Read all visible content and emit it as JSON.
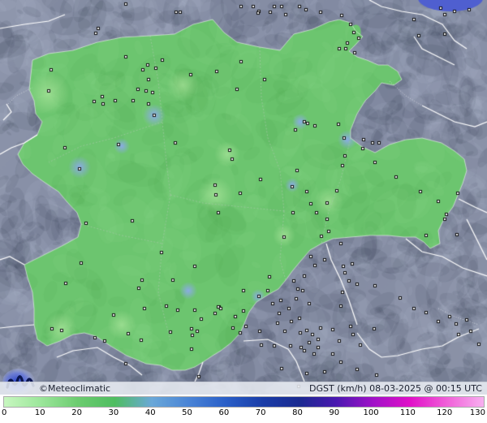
{
  "map": {
    "colors": {
      "ocean": "#4f5fd0",
      "terrain": "#8a92a8",
      "region_fill": "#6cc56f",
      "region_edge": "#5cb860",
      "border_line": "#ffffff",
      "province_line": "#9ec8a0",
      "hotspot": "#8ab4ee"
    }
  },
  "credit": "©Meteoclimatic",
  "caption": "DGST (km/h)   08-03-2025 @ 00:15 UTC",
  "legend": {
    "label": "DGST (km/h)",
    "ticks": [
      "0",
      "10",
      "20",
      "30",
      "40",
      "50",
      "60",
      "70",
      "80",
      "90",
      "100",
      "110",
      "120",
      "130"
    ],
    "stops": [
      "#c8f7c0",
      "#9be69a",
      "#6ccc70",
      "#4fbd60",
      "#6aa8d8",
      "#4a84d6",
      "#2a5fc8",
      "#1a3da8",
      "#1a2a90",
      "#4a18b0",
      "#a012c8",
      "#e010c8",
      "#f060d8",
      "#f8b0f0"
    ]
  },
  "stations": [
    [
      155,
      5
    ],
    [
      217,
      15
    ],
    [
      222,
      15
    ],
    [
      297,
      8
    ],
    [
      312,
      8
    ],
    [
      319,
      14
    ],
    [
      333,
      15
    ],
    [
      338,
      8
    ],
    [
      347,
      8
    ],
    [
      352,
      18
    ],
    [
      369,
      8
    ],
    [
      318,
      16
    ],
    [
      377,
      12
    ],
    [
      395,
      15
    ],
    [
      421,
      19
    ],
    [
      436,
      40
    ],
    [
      442,
      47
    ],
    [
      428,
      53
    ],
    [
      432,
      30
    ],
    [
      418,
      60
    ],
    [
      426,
      60
    ],
    [
      437,
      65
    ],
    [
      543,
      10
    ],
    [
      548,
      18
    ],
    [
      578,
      12
    ],
    [
      560,
      14
    ],
    [
      548,
      42
    ],
    [
      516,
      44
    ],
    [
      510,
      24
    ],
    [
      121,
      35
    ],
    [
      118,
      41
    ],
    [
      155,
      70
    ],
    [
      200,
      74
    ],
    [
      192,
      84
    ],
    [
      182,
      80
    ],
    [
      176,
      86
    ],
    [
      235,
      92
    ],
    [
      267,
      88
    ],
    [
      297,
      76
    ],
    [
      326,
      98
    ],
    [
      292,
      110
    ],
    [
      183,
      98
    ],
    [
      180,
      112
    ],
    [
      170,
      110
    ],
    [
      164,
      124
    ],
    [
      183,
      128
    ],
    [
      188,
      114
    ],
    [
      126,
      119
    ],
    [
      127,
      128
    ],
    [
      116,
      125
    ],
    [
      142,
      124
    ],
    [
      63,
      86
    ],
    [
      60,
      112
    ],
    [
      80,
      182
    ],
    [
      98,
      208
    ],
    [
      146,
      178
    ],
    [
      190,
      142
    ],
    [
      216,
      176
    ],
    [
      283,
      185
    ],
    [
      286,
      196
    ],
    [
      265,
      228
    ],
    [
      266,
      240
    ],
    [
      269,
      262
    ],
    [
      296,
      238
    ],
    [
      321,
      221
    ],
    [
      360,
      230
    ],
    [
      361,
      262
    ],
    [
      366,
      210
    ],
    [
      378,
      236
    ],
    [
      383,
      251
    ],
    [
      390,
      262
    ],
    [
      403,
      250
    ],
    [
      415,
      235
    ],
    [
      403,
      270
    ],
    [
      405,
      285
    ],
    [
      375,
      150
    ],
    [
      379,
      152
    ],
    [
      388,
      155
    ],
    [
      364,
      160
    ],
    [
      417,
      153
    ],
    [
      424,
      170
    ],
    [
      425,
      192
    ],
    [
      422,
      204
    ],
    [
      448,
      172
    ],
    [
      447,
      183
    ],
    [
      459,
      176
    ],
    [
      462,
      200
    ],
    [
      467,
      176
    ],
    [
      488,
      218
    ],
    [
      525,
      290
    ],
    [
      550,
      264
    ],
    [
      518,
      236
    ],
    [
      540,
      248
    ],
    [
      548,
      270
    ],
    [
      564,
      238
    ],
    [
      563,
      289
    ],
    [
      350,
      292
    ],
    [
      396,
      291
    ],
    [
      420,
      300
    ],
    [
      400,
      320
    ],
    [
      423,
      328
    ],
    [
      434,
      325
    ],
    [
      425,
      336
    ],
    [
      430,
      346
    ],
    [
      440,
      350
    ],
    [
      422,
      360
    ],
    [
      420,
      377
    ],
    [
      432,
      402
    ],
    [
      435,
      412
    ],
    [
      444,
      425
    ],
    [
      461,
      405
    ],
    [
      462,
      352
    ],
    [
      493,
      367
    ],
    [
      510,
      380
    ],
    [
      525,
      385
    ],
    [
      540,
      396
    ],
    [
      554,
      390
    ],
    [
      562,
      399
    ],
    [
      575,
      394
    ],
    [
      580,
      408
    ],
    [
      565,
      412
    ],
    [
      383,
      316
    ],
    [
      388,
      327
    ],
    [
      375,
      340
    ],
    [
      362,
      346
    ],
    [
      367,
      356
    ],
    [
      373,
      358
    ],
    [
      381,
      374
    ],
    [
      365,
      368
    ],
    [
      346,
      370
    ],
    [
      356,
      380
    ],
    [
      369,
      392
    ],
    [
      359,
      396
    ],
    [
      351,
      408
    ],
    [
      370,
      410
    ],
    [
      378,
      407
    ],
    [
      385,
      412
    ],
    [
      392,
      418
    ],
    [
      381,
      422
    ],
    [
      371,
      428
    ],
    [
      375,
      432
    ],
    [
      387,
      436
    ],
    [
      392,
      428
    ],
    [
      395,
      404
    ],
    [
      410,
      406
    ],
    [
      418,
      420
    ],
    [
      410,
      436
    ],
    [
      420,
      446
    ],
    [
      336,
      374
    ],
    [
      344,
      386
    ],
    [
      342,
      398
    ],
    [
      338,
      426
    ],
    [
      358,
      426
    ],
    [
      332,
      341
    ],
    [
      330,
      358
    ],
    [
      319,
      365
    ],
    [
      300,
      358
    ],
    [
      300,
      383
    ],
    [
      290,
      390
    ],
    [
      287,
      404
    ],
    [
      296,
      410
    ],
    [
      303,
      402
    ],
    [
      320,
      408
    ],
    [
      322,
      425
    ],
    [
      270,
      378
    ],
    [
      272,
      380
    ],
    [
      265,
      386
    ],
    [
      248,
      393
    ],
    [
      236,
      405
    ],
    [
      243,
      408
    ],
    [
      236,
      430
    ],
    [
      269,
      378
    ],
    [
      219,
      382
    ],
    [
      178,
      380
    ],
    [
      158,
      411
    ],
    [
      174,
      419
    ],
    [
      155,
      448
    ],
    [
      140,
      388
    ],
    [
      171,
      355
    ],
    [
      175,
      345
    ],
    [
      213,
      345
    ],
    [
      205,
      377
    ],
    [
      199,
      311
    ],
    [
      240,
      328
    ],
    [
      240,
      382
    ],
    [
      237,
      413
    ],
    [
      210,
      409
    ],
    [
      117,
      416
    ],
    [
      129,
      420
    ],
    [
      76,
      407
    ],
    [
      64,
      405
    ],
    [
      81,
      349
    ],
    [
      100,
      324
    ],
    [
      163,
      272
    ],
    [
      106,
      275
    ],
    [
      245,
      464
    ],
    [
      347,
      454
    ],
    [
      464,
      462
    ],
    [
      440,
      455
    ],
    [
      378,
      460
    ],
    [
      368,
      476
    ],
    [
      400,
      458
    ],
    [
      590,
      424
    ]
  ]
}
